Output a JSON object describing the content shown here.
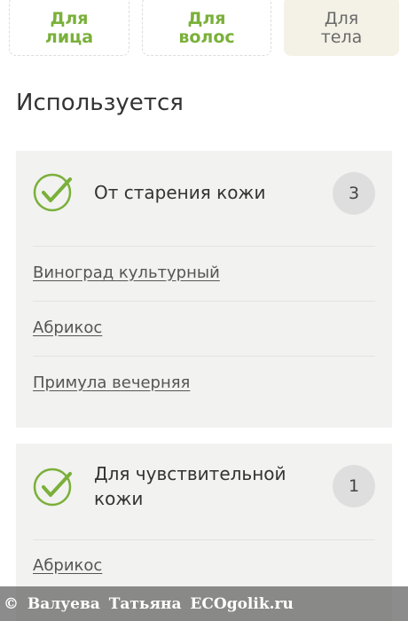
{
  "tabs": [
    {
      "label": "Для\nлица",
      "active": false
    },
    {
      "label": "Для\nволос",
      "active": false
    },
    {
      "label": "Для\nтела",
      "active": true
    }
  ],
  "section_title": "Используется",
  "cards": [
    {
      "title": "От старения кожи",
      "count": "3",
      "ingredients": [
        "Виноград культурный",
        "Абрикос",
        "Примула вечерняя"
      ]
    },
    {
      "title": "Для чувствительной\nкожи",
      "count": "1",
      "ingredients": [
        "Абрикос"
      ]
    }
  ],
  "watermark": "© Валуева Татьяна ECOgolik.ru",
  "colors": {
    "accent_green": "#7ab03a",
    "active_tab_bg": "#f4f1e6",
    "card_bg": "#f2f2f0",
    "badge_bg": "#dedede"
  },
  "icons": {
    "check": "check-circle-icon",
    "copyright": "copyright-icon"
  }
}
